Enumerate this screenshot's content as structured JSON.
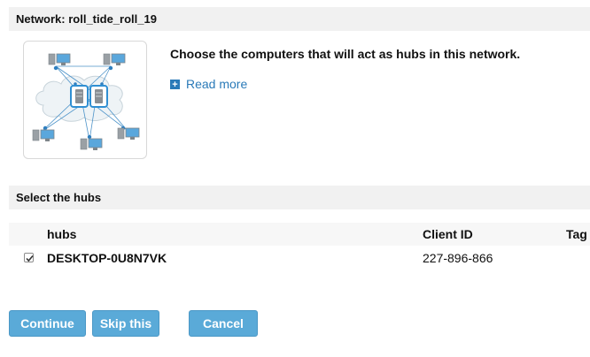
{
  "header": {
    "network_label": "Network: roll_tide_roll_19"
  },
  "intro": {
    "heading": "Choose the computers that will act as hubs in this network.",
    "read_more": "Read more",
    "read_more_icon": "plus-box-icon"
  },
  "hubs_section": {
    "title": "Select the hubs",
    "columns": {
      "hubs": "hubs",
      "client_id": "Client ID",
      "tag": "Tag"
    },
    "rows": [
      {
        "checked": true,
        "name": "DESKTOP-0U8N7VK",
        "client_id": "227-896-866",
        "tag": ""
      }
    ]
  },
  "buttons": {
    "continue": "Continue",
    "skip": "Skip this",
    "cancel": "Cancel"
  },
  "colors": {
    "accent": "#5aaad8",
    "link": "#2a7ab8",
    "section_bg": "#f1f1f1",
    "hub_blue": "#3a9ad9"
  }
}
